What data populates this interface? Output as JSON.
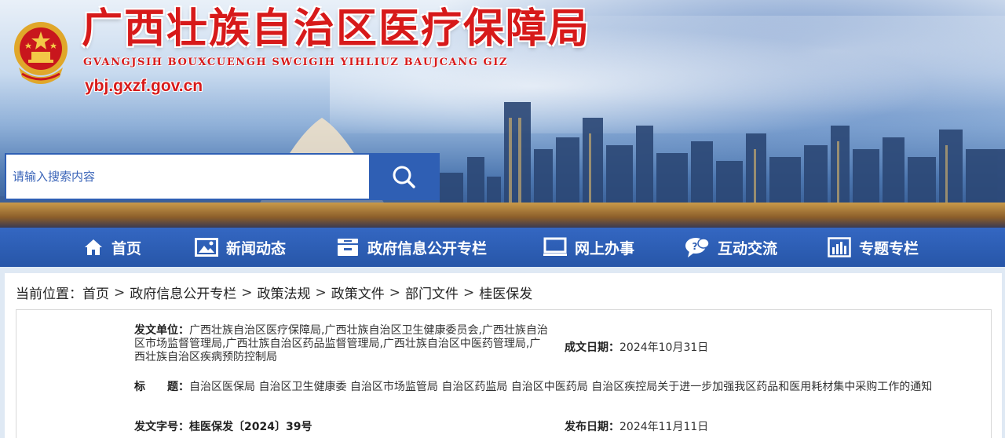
{
  "header": {
    "title": "广西壮族自治区医疗保障局",
    "subtitle": "GVANGJSIH BOUXCUENGH SWCIGIH YIHLIUZ BAUJCANG GIZ",
    "domain": "ybj.gxzf.gov.cn"
  },
  "search": {
    "placeholder": "请输入搜索内容",
    "icon": "search-icon"
  },
  "nav": {
    "items": [
      {
        "label": "首页",
        "icon": "home-icon"
      },
      {
        "label": "新闻动态",
        "icon": "image-icon"
      },
      {
        "label": "政府信息公开专栏",
        "icon": "cabinet-icon"
      },
      {
        "label": "网上办事",
        "icon": "monitor-icon"
      },
      {
        "label": "互动交流",
        "icon": "chat-bubble-icon"
      },
      {
        "label": "专题专栏",
        "icon": "bar-chart-icon"
      }
    ]
  },
  "breadcrumb": {
    "prefix": "当前位置：",
    "items": [
      "首页",
      "政府信息公开专栏",
      "政策法规",
      "政策文件",
      "部门文件",
      "桂医保发"
    ],
    "separator": ">"
  },
  "document": {
    "issuer_label": "发文单位：",
    "issuer_value": "广西壮族自治区医疗保障局,广西壮族自治区卫生健康委员会,广西壮族自治区市场监督管理局,广西壮族自治区药品监督管理局,广西壮族自治区中医药管理局,广西壮族自治区疾病预防控制局",
    "date_label": "成文日期：",
    "date_value": "2024年10月31日",
    "title_label": "标　　题：",
    "title_value": "自治区医保局 自治区卫生健康委 自治区市场监管局 自治区药监局 自治区中医药局 自治区疾控局关于进一步加强我区药品和医用耗材集中采购工作的通知",
    "docno_label": "发文字号：",
    "docno_value": "桂医保发〔2024〕39号",
    "pub_label": "发布日期：",
    "pub_value": "2024年11月11日"
  },
  "colors": {
    "title_red": "#d71a1a",
    "nav_blue": "#2f5fb4"
  }
}
